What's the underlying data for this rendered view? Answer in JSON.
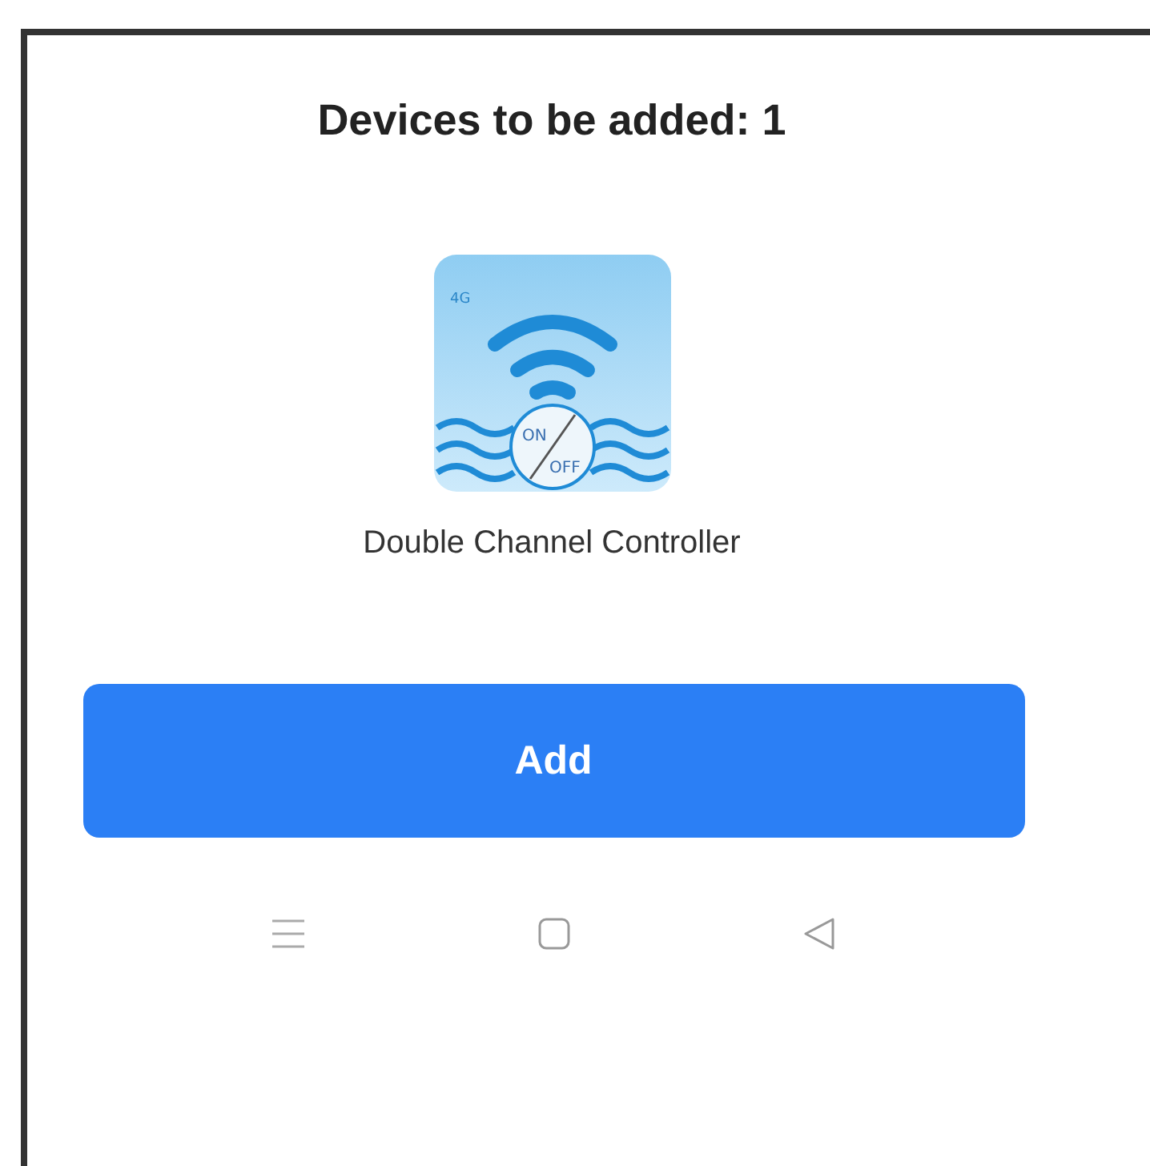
{
  "dialog": {
    "title": "Devices to be added: 1"
  },
  "device": {
    "name": "Double Channel Controller",
    "icon_texts": [
      "4G",
      "ON",
      "OFF"
    ]
  },
  "add_button": {
    "label": "Add"
  }
}
